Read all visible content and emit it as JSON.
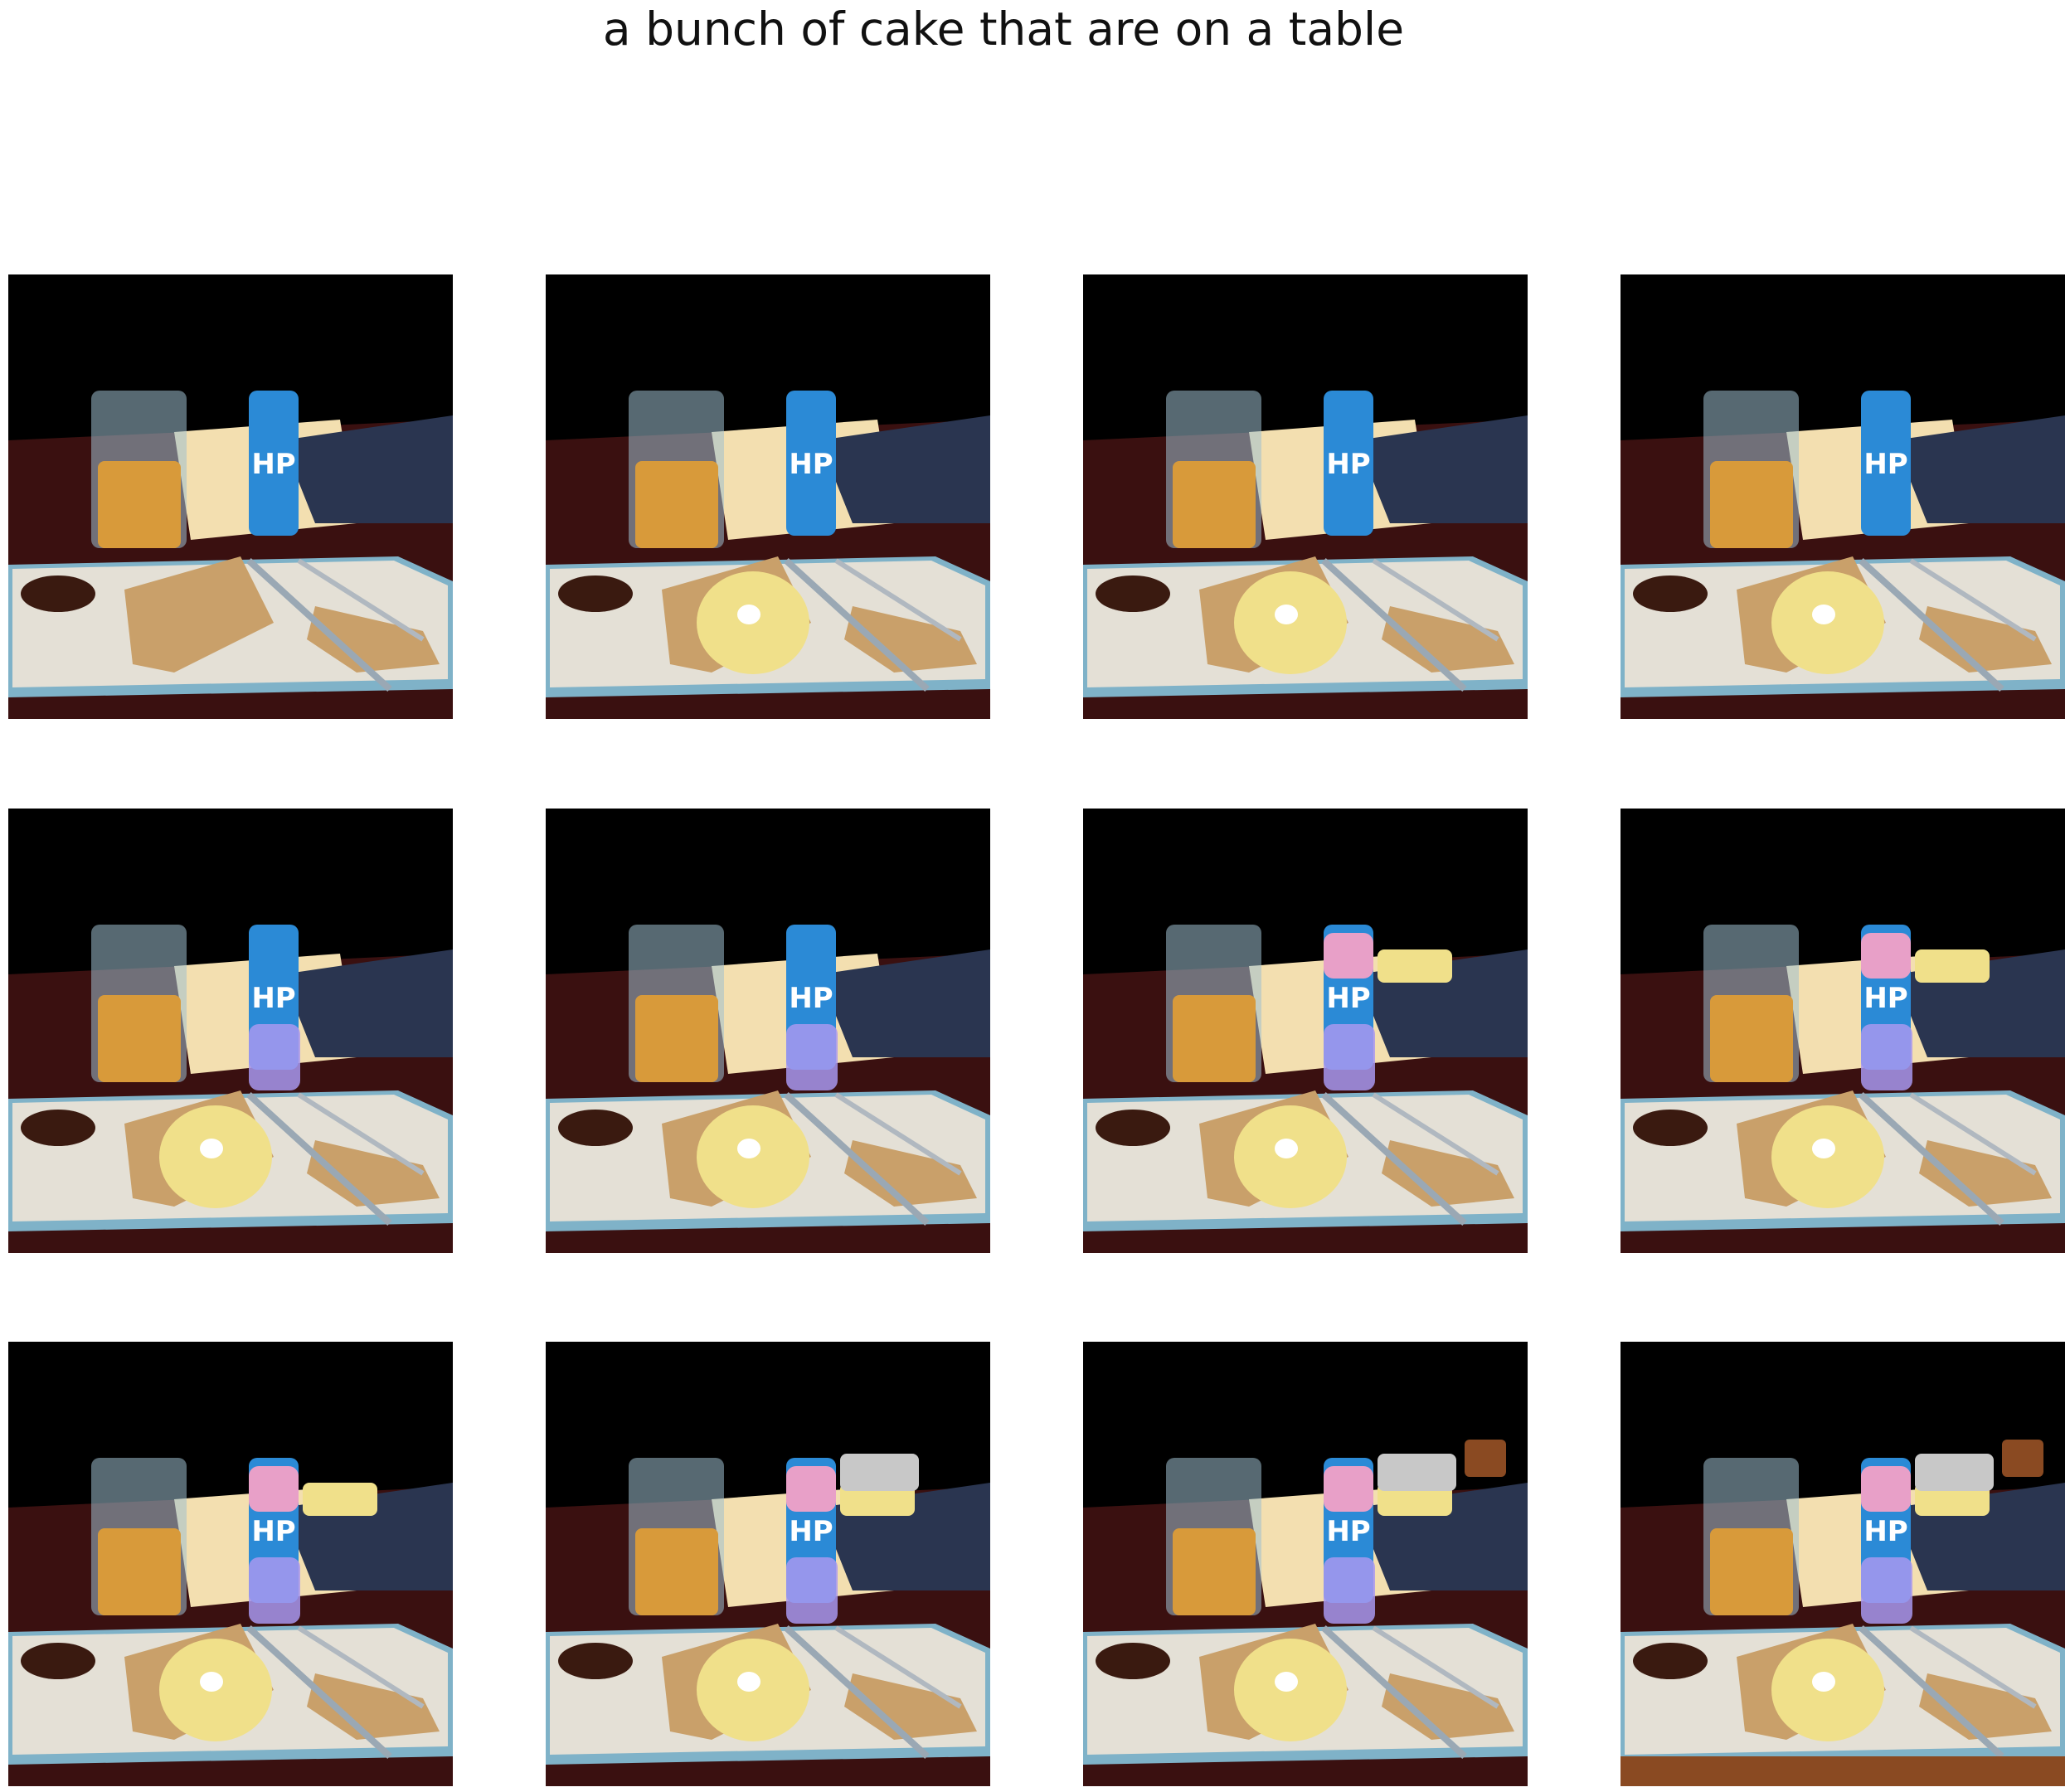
{
  "figure": {
    "title": "a bunch of cake that are on a table",
    "rows": 3,
    "cols": 4
  },
  "frames": [
    {
      "step": 1,
      "cake_on_plate": false,
      "cake_on_bottle": false,
      "cake_top": false,
      "cake_foil": false,
      "cake_far": false,
      "wood_floor": false
    },
    {
      "step": 2,
      "cake_on_plate": true,
      "cake_on_bottle": false,
      "cake_top": false,
      "cake_foil": false,
      "cake_far": false,
      "wood_floor": false
    },
    {
      "step": 3,
      "cake_on_plate": true,
      "cake_on_bottle": false,
      "cake_top": false,
      "cake_foil": false,
      "cake_far": false,
      "wood_floor": false
    },
    {
      "step": 4,
      "cake_on_plate": true,
      "cake_on_bottle": false,
      "cake_top": false,
      "cake_foil": false,
      "cake_far": false,
      "wood_floor": false
    },
    {
      "step": 5,
      "cake_on_plate": true,
      "cake_on_bottle": true,
      "cake_top": false,
      "cake_foil": false,
      "cake_far": false,
      "wood_floor": false
    },
    {
      "step": 6,
      "cake_on_plate": true,
      "cake_on_bottle": true,
      "cake_top": false,
      "cake_foil": false,
      "cake_far": false,
      "wood_floor": false
    },
    {
      "step": 7,
      "cake_on_plate": true,
      "cake_on_bottle": true,
      "cake_top": true,
      "cake_foil": false,
      "cake_far": false,
      "wood_floor": false
    },
    {
      "step": 8,
      "cake_on_plate": true,
      "cake_on_bottle": true,
      "cake_top": true,
      "cake_foil": false,
      "cake_far": false,
      "wood_floor": false
    },
    {
      "step": 9,
      "cake_on_plate": true,
      "cake_on_bottle": true,
      "cake_top": true,
      "cake_foil": false,
      "cake_far": false,
      "wood_floor": false
    },
    {
      "step": 10,
      "cake_on_plate": true,
      "cake_on_bottle": true,
      "cake_top": true,
      "cake_foil": true,
      "cake_far": false,
      "wood_floor": false
    },
    {
      "step": 11,
      "cake_on_plate": true,
      "cake_on_bottle": true,
      "cake_top": true,
      "cake_foil": true,
      "cake_far": true,
      "wood_floor": false
    },
    {
      "step": 12,
      "cake_on_plate": true,
      "cake_on_bottle": true,
      "cake_top": true,
      "cake_foil": true,
      "cake_far": true,
      "wood_floor": true
    }
  ],
  "scene": {
    "bottle_label": "HP",
    "colors": {
      "background": "#000000",
      "table": "#3a1010",
      "plate": "#e4e0d6",
      "plate_rim": "#7fb2c8",
      "beer": "#d89a3a",
      "glass": "#9fc0d0",
      "bottle": "#2b8ad6",
      "bottle_label_text": "#ffffff",
      "paper": "#f3dfb0",
      "napkin": "#2a3550",
      "toast": "#c9a06a",
      "sauce": "#3a1a10",
      "cake": "#f0e08a",
      "cake_highlight": "#ffffff",
      "cake_pink": "#e8a0c8",
      "cake_purple": "#a898f0",
      "foil": "#c8c8c8",
      "wood": "#8a4a22"
    }
  }
}
